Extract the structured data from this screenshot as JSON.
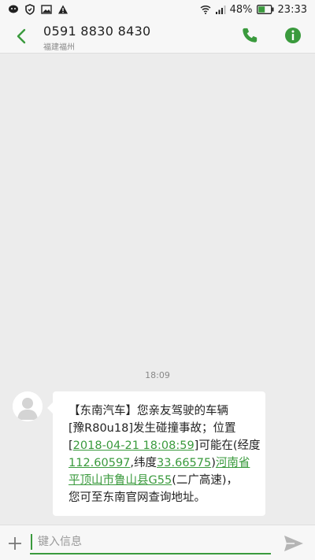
{
  "status": {
    "battery": "48%",
    "time": "23:33"
  },
  "header": {
    "phone": "0591 8830 8430",
    "location": "福建福州"
  },
  "thread": {
    "timestamp": "18:09"
  },
  "message": {
    "l1": "【东南汽车】您亲友驾驶的车辆",
    "l2": "[豫R80u18]发生碰撞事故；位置",
    "l3a": "[",
    "l3link": "2018-04-21 18:08:59",
    "l3b": "]可能在(经度",
    "l4link1": "112.60597",
    "l4mid": ",纬度",
    "l4link2": "33.66575",
    "l4b": ")",
    "l4link3": "河南省",
    "l5link": "平顶山市鲁山县G55",
    "l5b": "(二广高速)，",
    "l6": "您可至东南官网查询地址。"
  },
  "input": {
    "placeholder": "键入信息"
  },
  "colors": {
    "accent": "#3a9a3d"
  }
}
